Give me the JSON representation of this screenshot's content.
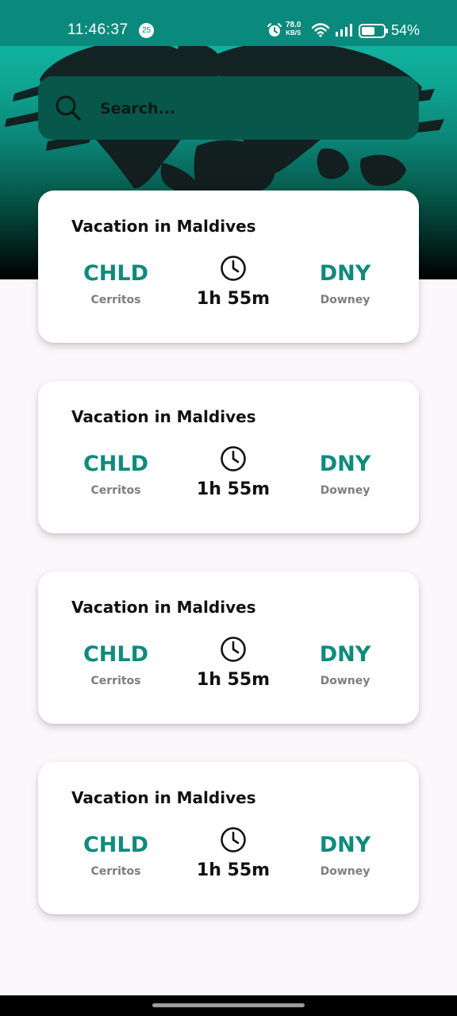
{
  "status_bar": {
    "time": "11:46:37",
    "notification_count": "25",
    "net_speed_value": "78.0",
    "net_speed_unit": "KB/S",
    "battery_percent": "54%"
  },
  "search": {
    "placeholder": "Search..."
  },
  "trips": [
    {
      "title": "Vacation in Maldives",
      "from_code": "CHLD",
      "from_city": "Cerritos",
      "duration": "1h 55m",
      "to_code": "DNY",
      "to_city": "Downey"
    },
    {
      "title": "Vacation in Maldives",
      "from_code": "CHLD",
      "from_city": "Cerritos",
      "duration": "1h 55m",
      "to_code": "DNY",
      "to_city": "Downey"
    },
    {
      "title": "Vacation in Maldives",
      "from_code": "CHLD",
      "from_city": "Cerritos",
      "duration": "1h 55m",
      "to_code": "DNY",
      "to_city": "Downey"
    },
    {
      "title": "Vacation in Maldives",
      "from_code": "CHLD",
      "from_city": "Cerritos",
      "duration": "1h 55m",
      "to_code": "DNY",
      "to_city": "Downey"
    }
  ],
  "colors": {
    "accent": "#0f8b7c",
    "header": "#10b5a2",
    "search_background": "#07574a",
    "page_background": "#fcf7fb"
  }
}
